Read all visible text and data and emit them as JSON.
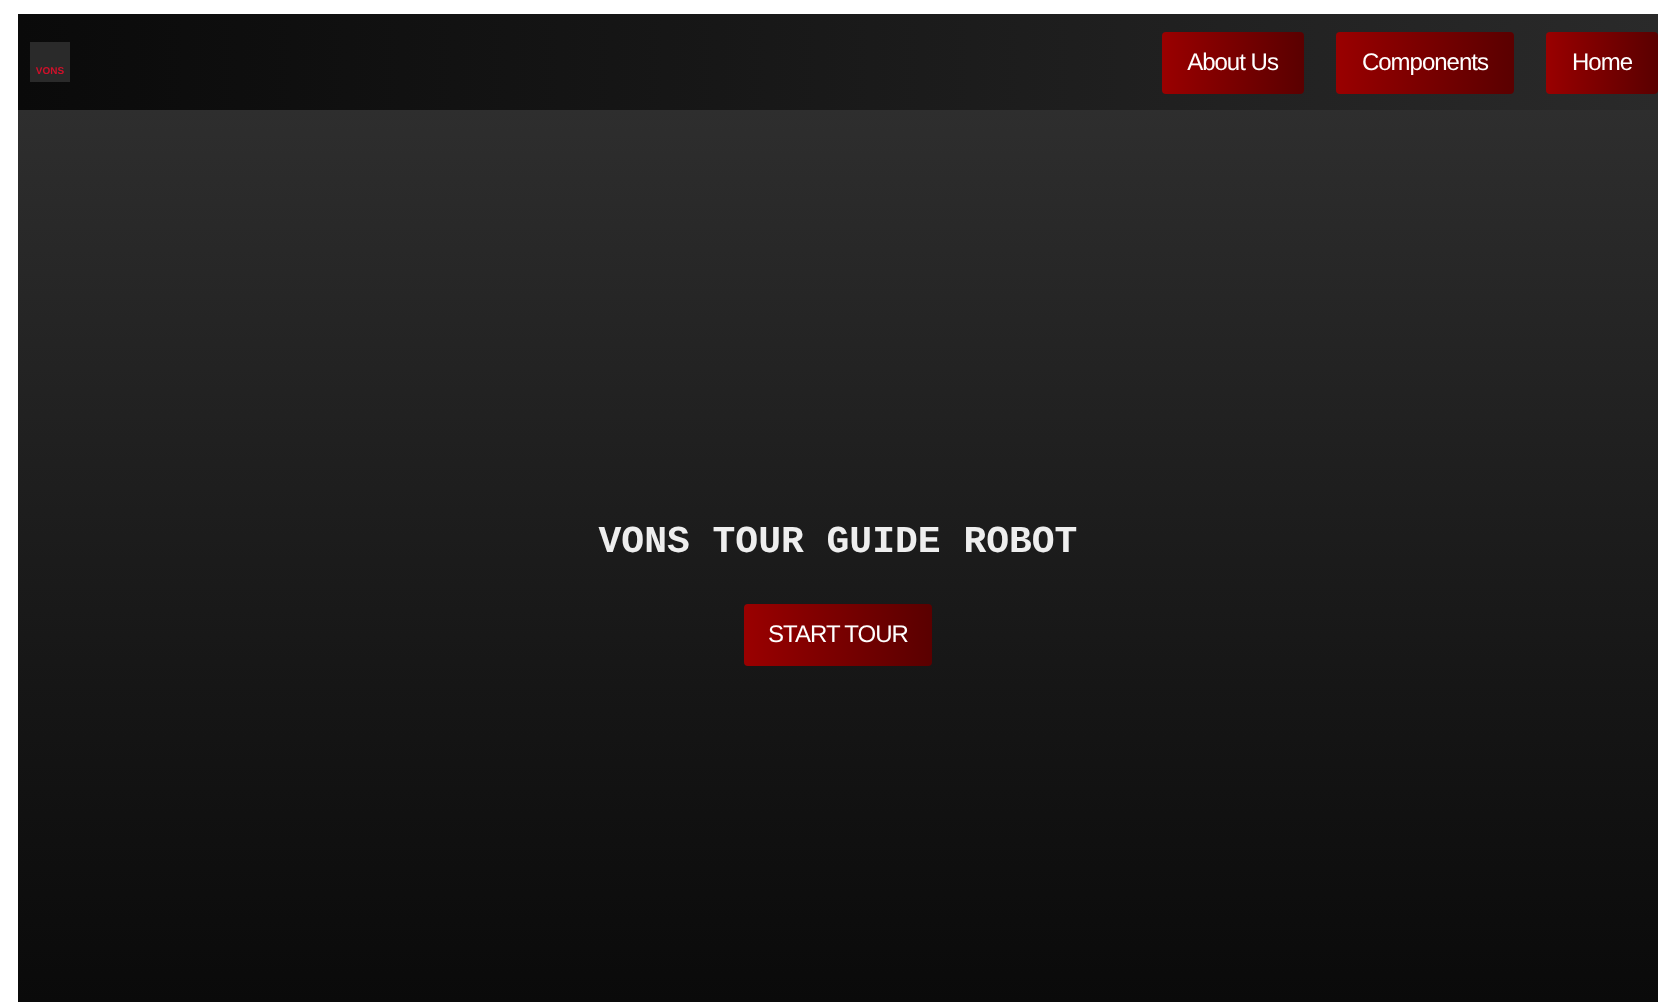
{
  "header": {
    "logo_text": "VONS",
    "nav": [
      {
        "label": "About Us"
      },
      {
        "label": "Components"
      },
      {
        "label": "Home"
      }
    ]
  },
  "hero": {
    "title": "VONS TOUR GUIDE ROBOT",
    "button": "START TOUR"
  }
}
